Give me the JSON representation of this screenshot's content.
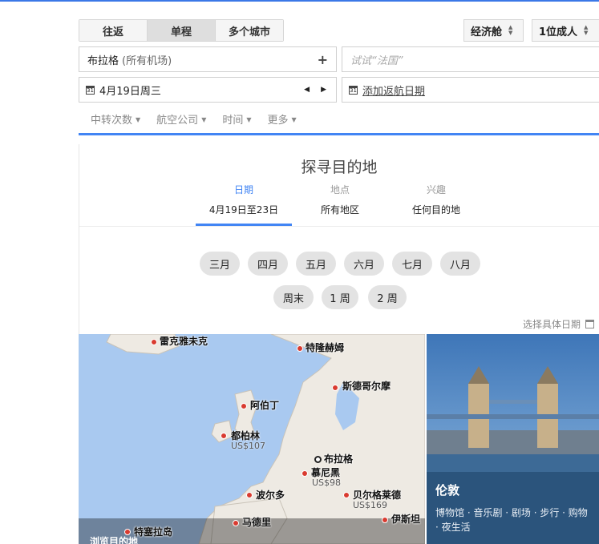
{
  "trip_types": [
    "往返",
    "单程",
    "多个城市"
  ],
  "active_trip_type": "单程",
  "cabin_class": "经济舱",
  "passengers": "1位成人",
  "origin": {
    "city": "布拉格",
    "detail": "(所有机场)"
  },
  "destination": {
    "placeholder": "试试“法国”"
  },
  "depart_date": "4月19日周三",
  "return_date": "添加返航日期",
  "filters": [
    "中转次数",
    "航空公司",
    "时间",
    "更多"
  ],
  "explore": {
    "title": "探寻目的地",
    "tabs": [
      {
        "label": "日期",
        "value": "4月19日至23日"
      },
      {
        "label": "地点",
        "value": "所有地区"
      },
      {
        "label": "兴趣",
        "value": "任何目的地"
      }
    ],
    "months": [
      "三月",
      "四月",
      "五月",
      "六月",
      "七月",
      "八月"
    ],
    "durations": [
      "周末",
      "1 周",
      "2 周"
    ],
    "pick_dates": "选择具体日期"
  },
  "map": {
    "cities": [
      {
        "name": "雷克雅未克"
      },
      {
        "name": "特隆赫姆"
      },
      {
        "name": "斯德哥尔摩"
      },
      {
        "name": "阿伯丁"
      },
      {
        "name": "都柏林",
        "price": "US$107"
      },
      {
        "name": "布拉格"
      },
      {
        "name": "慕尼黑",
        "price": "US$98"
      },
      {
        "name": "波尔多"
      },
      {
        "name": "贝尔格莱德",
        "price": "US$169"
      },
      {
        "name": "伊斯坦"
      },
      {
        "name": "马德里"
      },
      {
        "name": "特塞拉岛"
      }
    ],
    "browse_label": "浏览目的地"
  },
  "card": {
    "title": "伦敦",
    "subtitle": "博物馆 · 音乐剧 · 剧场 · 步行 · 购物 · 夜生活"
  }
}
